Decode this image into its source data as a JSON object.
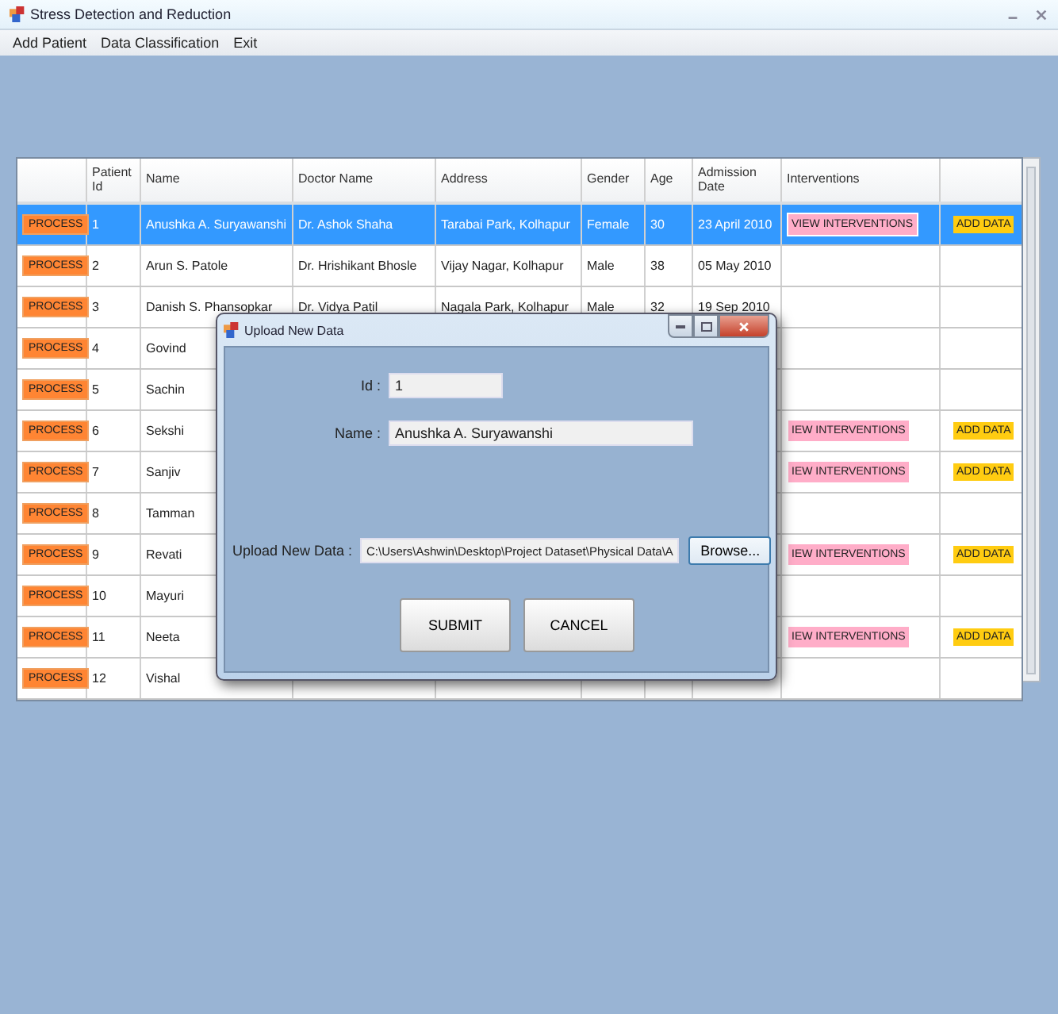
{
  "window": {
    "title": "Stress Detection and Reduction"
  },
  "menu": [
    "Add Patient",
    "Data Classification",
    "Exit"
  ],
  "table": {
    "columns": [
      "",
      "Patient Id",
      "Name",
      "Doctor Name",
      "Address",
      "Gender",
      "Age",
      "Admission Date",
      "Interventions",
      ""
    ],
    "rows": [
      {
        "process": "PROCESS",
        "id": "1",
        "name": "Anushka A. Suryawanshi",
        "doctor": "Dr. Ashok Shaha",
        "address": "Tarabai Park, Kolhapur",
        "gender": "Female",
        "age": "30",
        "date": "23 April 2010",
        "interventions": "VIEW INTERVENTIONS",
        "add_data": "ADD DATA",
        "selected": true
      },
      {
        "process": "PROCESS",
        "id": "2",
        "name": "Arun S. Patole",
        "doctor": "Dr. Hrishikant Bhosle",
        "address": "Vijay Nagar, Kolhapur",
        "gender": "Male",
        "age": "38",
        "date": "05 May 2010",
        "selected": false
      },
      {
        "process": "PROCESS",
        "id": "3",
        "name": "Danish S. Phansopkar",
        "doctor": "Dr. Vidya Patil",
        "address": "Nagala Park, Kolhapur",
        "gender": "Male",
        "age": "32",
        "date": "19 Sep 2010",
        "selected": false
      },
      {
        "process": "PROCESS",
        "id": "4",
        "name": "Govind",
        "selected": false
      },
      {
        "process": "PROCESS",
        "id": "5",
        "name": "Sachin",
        "selected": false
      },
      {
        "process": "PROCESS",
        "id": "6",
        "name": "Sekshi",
        "interventions": "IEW INTERVENTIONS",
        "add_data": "ADD DATA",
        "selected": false
      },
      {
        "process": "PROCESS",
        "id": "7",
        "name": "Sanjiv",
        "interventions": "IEW INTERVENTIONS",
        "add_data": "ADD DATA",
        "selected": false
      },
      {
        "process": "PROCESS",
        "id": "8",
        "name": "Tamman",
        "selected": false
      },
      {
        "process": "PROCESS",
        "id": "9",
        "name": "Revati",
        "interventions": "IEW INTERVENTIONS",
        "add_data": "ADD DATA",
        "selected": false
      },
      {
        "process": "PROCESS",
        "id": "10",
        "name": "Mayuri",
        "selected": false
      },
      {
        "process": "PROCESS",
        "id": "11",
        "name": "Neeta",
        "interventions": "IEW INTERVENTIONS",
        "add_data": "ADD DATA",
        "selected": false
      },
      {
        "process": "PROCESS",
        "id": "12",
        "name": "Vishal",
        "selected": false
      }
    ]
  },
  "dialog": {
    "title": "Upload New Data",
    "id_label": "Id :",
    "id_value": "1",
    "name_label": "Name :",
    "name_value": "Anushka A. Suryawanshi",
    "upload_label": "Upload New Data :",
    "upload_value": "C:\\Users\\Ashwin\\Desktop\\Project Dataset\\Physical Data\\A",
    "browse": "Browse...",
    "submit": "SUBMIT",
    "cancel": "CANCEL"
  }
}
